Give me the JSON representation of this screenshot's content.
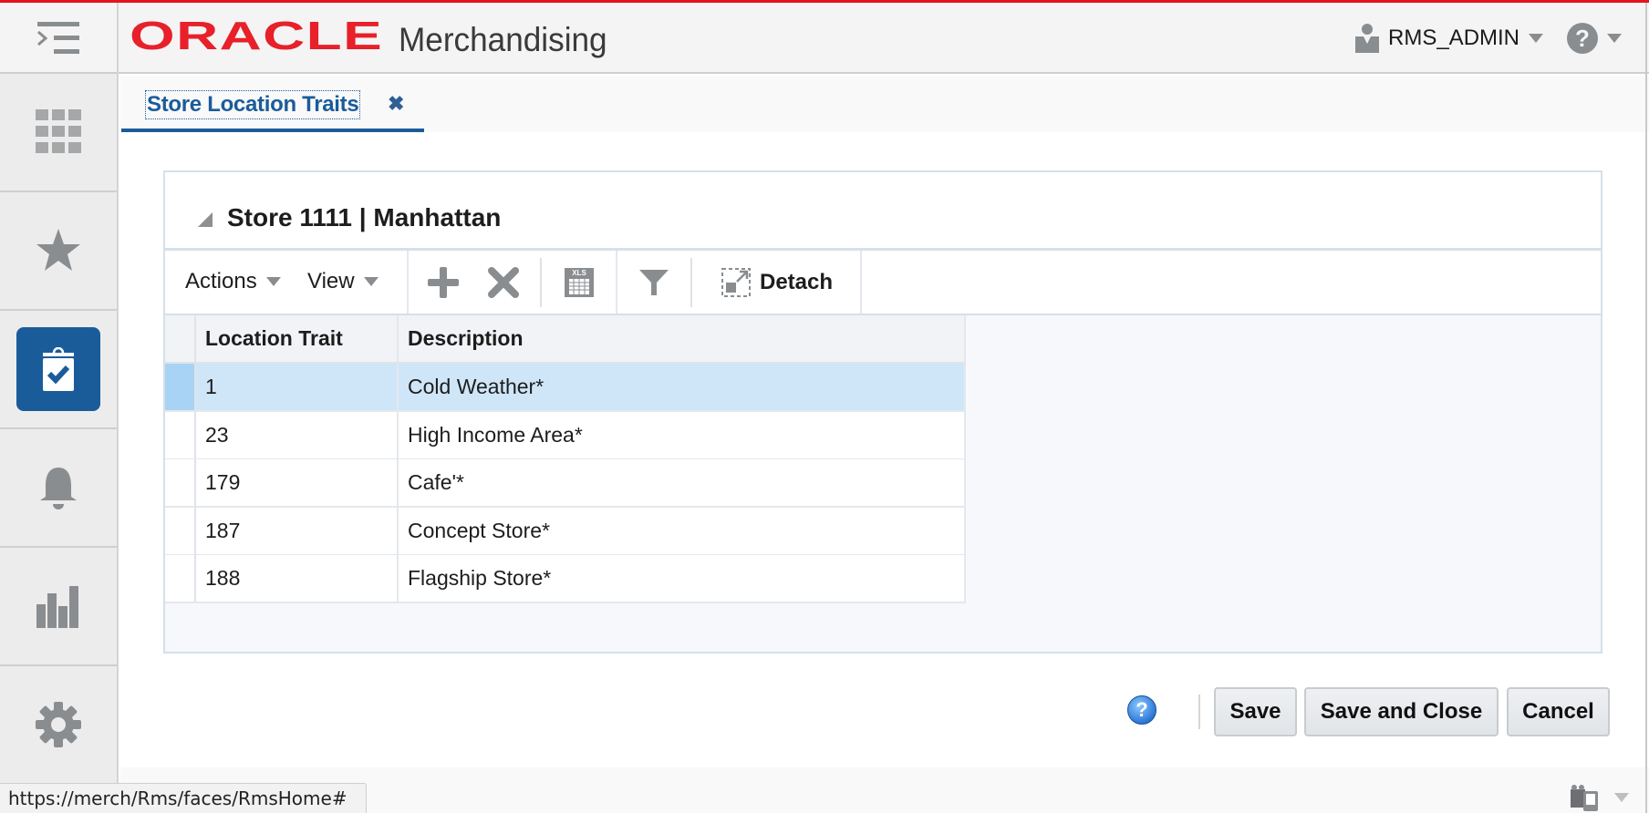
{
  "header": {
    "brand": "ORACLE",
    "app_name": "Merchandising",
    "user": "RMS_ADMIN",
    "menu_icon": "hamburger-menu-icon",
    "user_icon": "user-icon",
    "help_icon": "help-icon",
    "help_glyph": "?"
  },
  "sidebar": {
    "items": [
      {
        "name": "tasks-grid",
        "icon": "grid-icon",
        "active": false
      },
      {
        "name": "favorites",
        "icon": "star-icon",
        "active": false
      },
      {
        "name": "tasks",
        "icon": "clipboard-check-icon",
        "active": true
      },
      {
        "name": "notifications",
        "icon": "bell-icon",
        "active": false
      },
      {
        "name": "reports",
        "icon": "bar-chart-icon",
        "active": false
      },
      {
        "name": "settings",
        "icon": "gear-icon",
        "active": false
      }
    ]
  },
  "tabs": [
    {
      "label": "Store Location Traits",
      "close_glyph": "✖",
      "active": true
    }
  ],
  "panel": {
    "title": "Store 1111 | Manhattan",
    "toolbar": {
      "actions_label": "Actions",
      "view_label": "View",
      "add_icon": "plus-icon",
      "delete_icon": "delete-x-icon",
      "export_icon": "xls-export-icon",
      "export_badge": "XLS",
      "filter_icon": "filter-icon",
      "detach_label": "Detach"
    },
    "table": {
      "columns": [
        "Location Trait",
        "Description"
      ],
      "rows": [
        {
          "trait": "1",
          "description": "Cold Weather*",
          "selected": true
        },
        {
          "trait": "23",
          "description": "High Income Area*",
          "selected": false
        },
        {
          "trait": "179",
          "description": "Cafe'*",
          "selected": false
        },
        {
          "trait": "187",
          "description": "Concept Store*",
          "selected": false
        },
        {
          "trait": "188",
          "description": "Flagship Store*",
          "selected": false
        }
      ]
    }
  },
  "footer": {
    "help_glyph": "?",
    "save_label": "Save",
    "save_close_label": "Save and Close",
    "cancel_label": "Cancel"
  },
  "status_bar": {
    "url": "https://merch/Rms/faces/RmsHome#"
  },
  "colors": {
    "brand_red": "#e8202a",
    "accent_blue": "#1a5c9a",
    "selected_row": "#cfe6f9"
  }
}
